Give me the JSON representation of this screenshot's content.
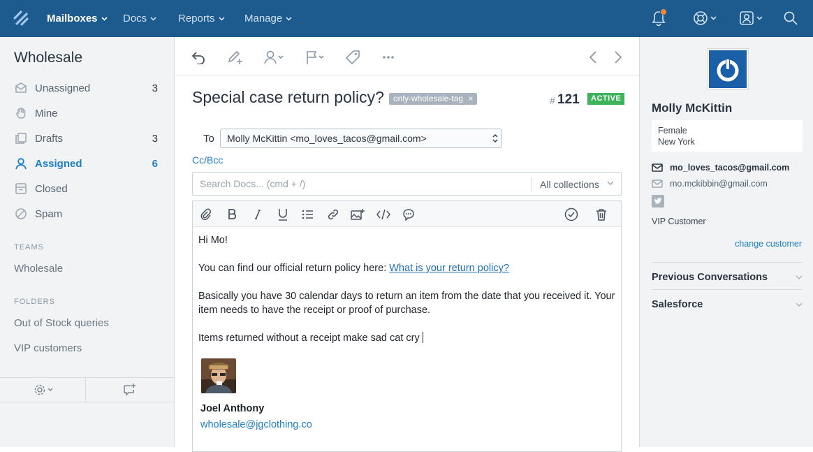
{
  "topbar": {
    "nav": [
      {
        "label": "Mailboxes",
        "active": true
      },
      {
        "label": "Docs",
        "active": false
      },
      {
        "label": "Reports",
        "active": false
      },
      {
        "label": "Manage",
        "active": false
      }
    ],
    "icons": [
      "logo-icon",
      "notification-bell-icon",
      "help-icon",
      "account-icon",
      "search-icon"
    ],
    "colors": {
      "bar": "#1d5a8e",
      "notification_dot": "#f5893b"
    }
  },
  "sidebar": {
    "title": "Wholesale",
    "items": [
      {
        "label": "Unassigned",
        "count": "3",
        "icon": "inbox-icon"
      },
      {
        "label": "Mine",
        "count": "",
        "icon": "hand-icon"
      },
      {
        "label": "Drafts",
        "count": "3",
        "icon": "drafts-icon"
      },
      {
        "label": "Assigned",
        "count": "6",
        "icon": "user-icon",
        "active": true
      },
      {
        "label": "Closed",
        "count": "",
        "icon": "archive-icon"
      },
      {
        "label": "Spam",
        "count": "",
        "icon": "spam-icon"
      }
    ],
    "teams_heading": "TEAMS",
    "teams": [
      "Wholesale"
    ],
    "folders_heading": "FOLDERS",
    "folders": [
      "Out of Stock queries",
      "VIP customers"
    ],
    "footer_icons": [
      "settings-icon",
      "new-conversation-icon"
    ]
  },
  "conversation": {
    "subject": "Special case return policy?",
    "tag": "only-wholesale-tag",
    "tag_remove": "×",
    "ticket_hash": "#",
    "ticket_number": "121",
    "status": "ACTIVE",
    "to_label": "To",
    "to_value": "Molly McKittin <mo_loves_tacos@gmail.com>",
    "cc_bcc": "Cc/Bcc",
    "docs_search": {
      "placeholder": "Search Docs... (cmd + /)",
      "collection": "All collections"
    },
    "body": {
      "greeting": "Hi Mo!",
      "line1_text": "You can find our official return policy here: ",
      "line1_link": "What is your return policy?",
      "para2_line1": "Basically you have 30 calendar days to return an item from the date that you received it. Your",
      "para2_line2": "item needs to have the receipt or proof of purchase.",
      "para3": "Items returned without a receipt make sad cat cry"
    },
    "signature": {
      "name": "Joel Anthony",
      "email": "wholesale@jgclothing.co"
    }
  },
  "customer": {
    "name": "Molly McKittin",
    "gender": "Female",
    "location": "New York",
    "emails": [
      "mo_loves_tacos@gmail.com",
      "mo.mckibbin@gmail.com"
    ],
    "segment": "VIP Customer",
    "change_link": "change customer",
    "sections": [
      "Previous Conversations",
      "Salesforce"
    ],
    "colors": {
      "avatar_bg": "#1a5fa8",
      "status_active": "#3fb35a",
      "link": "#1e7fc6"
    }
  }
}
